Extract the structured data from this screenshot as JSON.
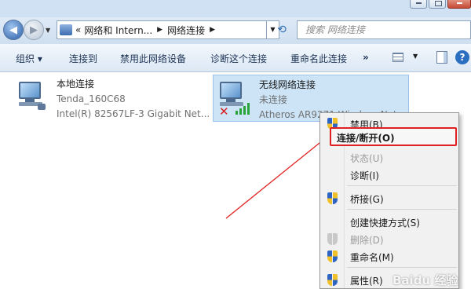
{
  "address": {
    "overflow": "«",
    "breadcrumbs": [
      {
        "label": "网络和 Intern..."
      },
      {
        "label": "网络连接"
      }
    ]
  },
  "search": {
    "placeholder": "搜索 网络连接"
  },
  "toolbar": {
    "organize": "组织 ▾",
    "connect_to": "连接到",
    "disable_device": "禁用此网络设备",
    "diagnose": "诊断这个连接",
    "rename": "重命名此连接",
    "more": "»"
  },
  "connections": [
    {
      "name": "本地连接",
      "status": "Tenda_160C68",
      "device": "Intel(R) 82567LF-3 Gigabit Net..."
    },
    {
      "name": "无线网络连接",
      "status": "未连接",
      "device": "Atheros AR9271 Wireless Net..."
    }
  ],
  "context_menu": {
    "items": [
      {
        "label": "禁用(B)",
        "shield": true,
        "disabled": false
      },
      {
        "label": "连接/断开(O)",
        "shield": false,
        "disabled": false,
        "bold": true,
        "highlighted": true
      },
      {
        "label": "状态(U)",
        "shield": false,
        "disabled": true
      },
      {
        "label": "诊断(I)",
        "shield": false,
        "disabled": false
      },
      {
        "label": "桥接(G)",
        "shield": true,
        "disabled": false
      },
      {
        "label": "创建快捷方式(S)",
        "shield": false,
        "disabled": false
      },
      {
        "label": "删除(D)",
        "shield": true,
        "disabled": true
      },
      {
        "label": "重命名(M)",
        "shield": true,
        "disabled": false
      },
      {
        "label": "属性(R)",
        "shield": true,
        "disabled": false
      }
    ]
  },
  "annotation": {
    "color": "#e02020"
  },
  "colors": {
    "selection": "#cde4f7",
    "wifi_bars": "#2aa33a",
    "error_x": "#d61e1e"
  },
  "watermark": "Baidu 经验"
}
